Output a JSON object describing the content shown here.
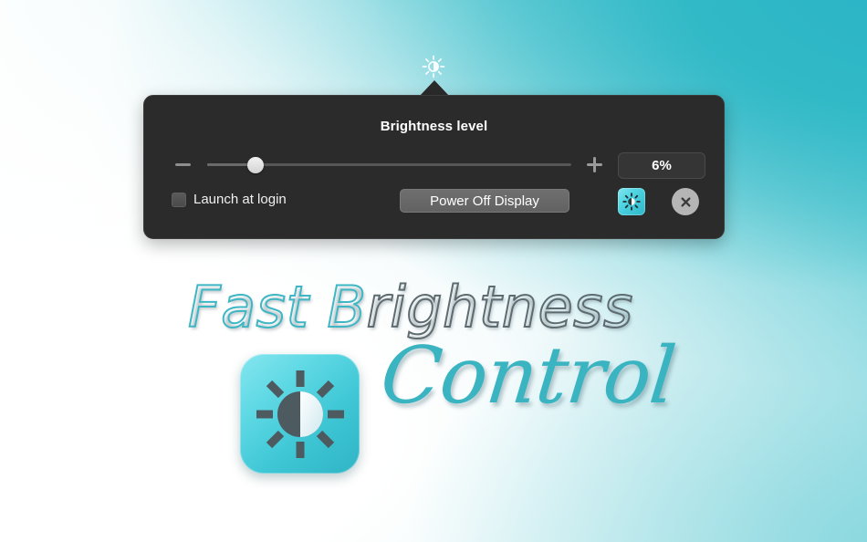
{
  "menubar": {
    "icon": "brightness-sun-icon"
  },
  "popover": {
    "title": "Brightness level",
    "slider": {
      "minus_icon": "minus-icon",
      "plus_icon": "plus-icon",
      "value_percent": 6,
      "min": 0,
      "max": 100,
      "knob_position_percent": 6
    },
    "value_display": "6%",
    "launch_at_login": {
      "label": "Launch at login",
      "checked": false
    },
    "power_off_button": "Power Off Display",
    "brightness_toggle_icon": "brightness-sun-icon",
    "close_icon": "close-x-icon"
  },
  "branding": {
    "line1_word1": "Fast",
    "line1_word2_cap": "B",
    "line1_word2_rest": "rightness",
    "line2": "Control",
    "app_icon": "brightness-sun-app-icon"
  },
  "colors": {
    "accent_teal": "#2eb8c6",
    "panel_bg": "#2b2b2b",
    "brand_teal": "#3bb4c2",
    "brand_gray": "#5e6b70"
  }
}
